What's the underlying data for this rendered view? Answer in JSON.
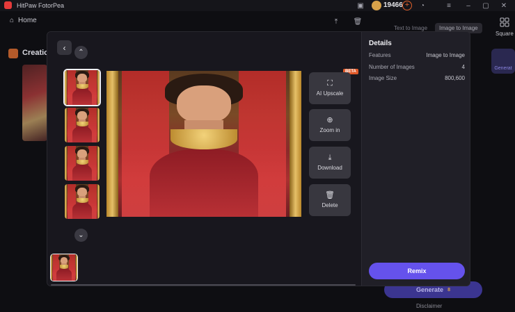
{
  "titlebar": {
    "app_name": "HitPaw FotorPea",
    "credits": "19466",
    "icons": [
      "upload-icon",
      "trash-icon",
      "minimize-icon",
      "maximize-icon",
      "close-icon"
    ]
  },
  "background": {
    "home_label": "Home",
    "creation_label": "Creatio",
    "tabs": [
      "Text to Image",
      "Image to Image"
    ],
    "square_label": "Square",
    "side_generate_label": "Generat",
    "generate_label": "Generate",
    "generate_cost": "8",
    "disclaimer": "Disclaimer"
  },
  "modal": {
    "tools": [
      {
        "label": "AI Upscale",
        "icon": "expand-icon"
      },
      {
        "label": "Zoom in",
        "icon": "zoom-in-icon"
      },
      {
        "label": "Download",
        "icon": "download-icon"
      },
      {
        "label": "Delete",
        "icon": "trash-icon"
      }
    ],
    "beta_badge": "BETA",
    "details": {
      "title": "Details",
      "rows": [
        {
          "label": "Features",
          "value": "Image to Image"
        },
        {
          "label": "Number of Images",
          "value": "4"
        },
        {
          "label": "Image Size",
          "value": "800,600"
        }
      ]
    },
    "remix_label": "Remix"
  },
  "colors": {
    "accent": "#6552ec",
    "modal_bg": "#1a1920",
    "panel_bg": "#201f27",
    "beta": "#e05a2a"
  }
}
